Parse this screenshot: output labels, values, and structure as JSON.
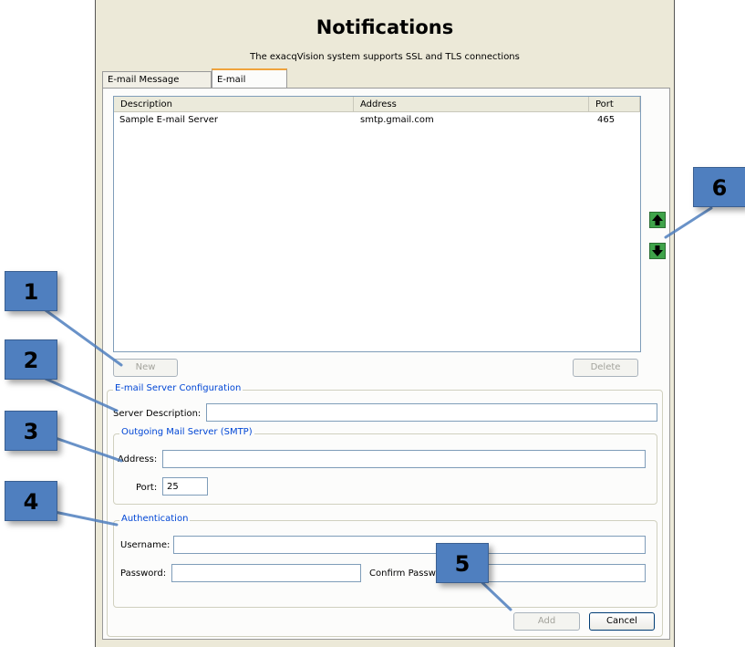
{
  "window": {
    "title": "Notifications",
    "subtitle": "The exacqVision system supports SSL and TLS connections"
  },
  "tabs": [
    {
      "label": "E-mail Message Profiles",
      "active": false
    },
    {
      "label": "E-mail Servers",
      "active": true
    }
  ],
  "server_list": {
    "columns": [
      "Description",
      "Address",
      "Port"
    ],
    "rows": [
      {
        "description": "Sample E-mail Server",
        "address": "smtp.gmail.com",
        "port": "465"
      }
    ]
  },
  "buttons": {
    "new": "New",
    "delete": "Delete",
    "add": "Add",
    "cancel": "Cancel"
  },
  "config": {
    "group_label": "E-mail Server Configuration",
    "server_description_label": "Server Description:",
    "server_description_value": "",
    "smtp_group_label": "Outgoing Mail Server (SMTP)",
    "address_label": "Address:",
    "address_value": "",
    "port_label": "Port:",
    "port_value": "25",
    "auth_group_label": "Authentication",
    "username_label": "Username:",
    "username_value": "",
    "password_label": "Password:",
    "confirm_password_label": "Confirm Password:"
  },
  "callouts": [
    "1",
    "2",
    "3",
    "4",
    "5",
    "6"
  ],
  "icons": {
    "move_up": "arrow-up-icon",
    "move_down": "arrow-down-icon"
  },
  "colors": {
    "window_bg": "#ece9d8",
    "group_label": "#0046d5",
    "callout": "#4f7fbf",
    "arrow_button": "#3fa34a",
    "active_tab_accent": "#f0a33c"
  }
}
